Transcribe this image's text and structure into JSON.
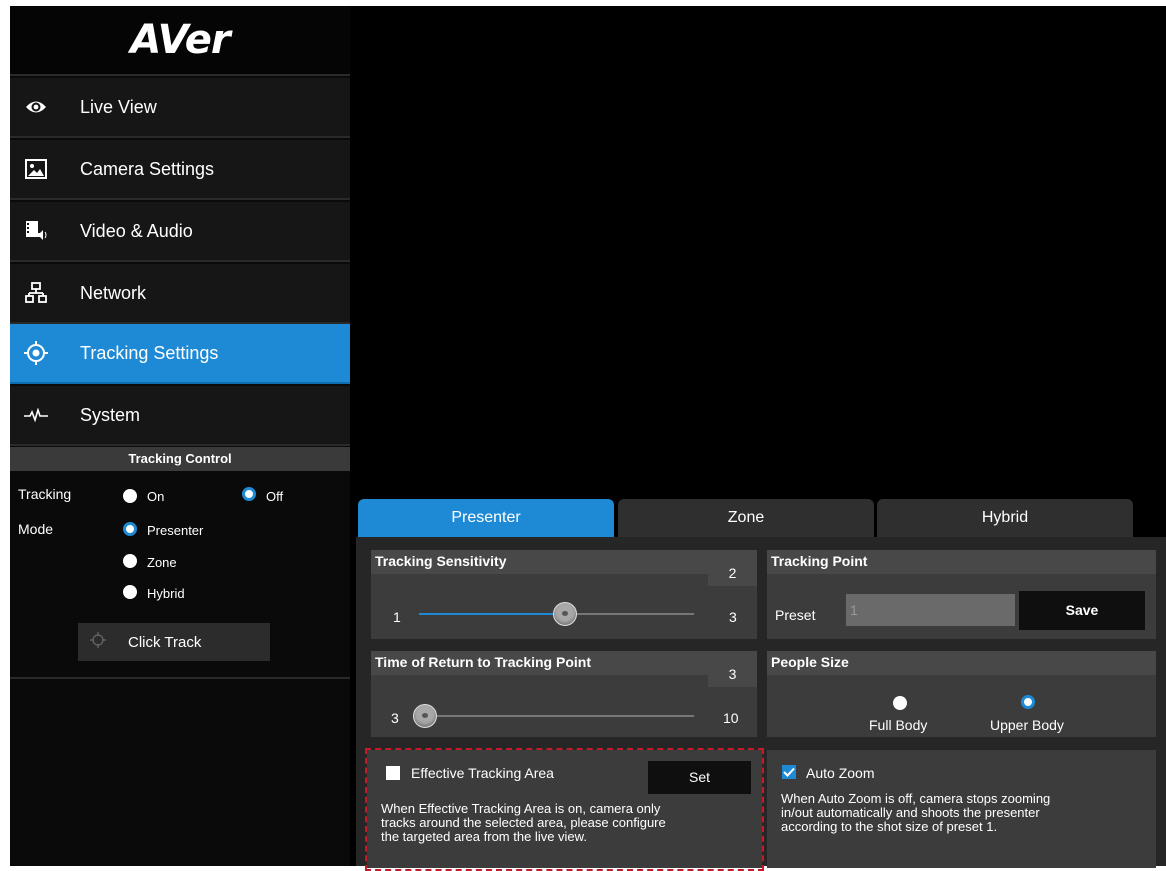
{
  "brand": {
    "logo_text": "AVer"
  },
  "sidebar": {
    "items": [
      {
        "label": "Live View",
        "icon": "eye-icon"
      },
      {
        "label": "Camera Settings",
        "icon": "image-icon"
      },
      {
        "label": "Video & Audio",
        "icon": "film-audio-icon"
      },
      {
        "label": "Network",
        "icon": "network-icon"
      },
      {
        "label": "Tracking Settings",
        "icon": "target-icon",
        "active": true
      },
      {
        "label": "System",
        "icon": "pulse-icon"
      }
    ]
  },
  "tracking_control": {
    "header": "Tracking Control",
    "tracking_label": "Tracking",
    "mode_label": "Mode",
    "on_label": "On",
    "off_label": "Off",
    "tracking_value": "Off",
    "modes": [
      "Presenter",
      "Zone",
      "Hybrid"
    ],
    "mode_value": "Presenter",
    "click_track_label": "Click Track"
  },
  "tabs": [
    {
      "label": "Presenter",
      "active": true
    },
    {
      "label": "Zone",
      "active": false
    },
    {
      "label": "Hybrid",
      "active": false
    }
  ],
  "sensitivity": {
    "title": "Tracking Sensitivity",
    "value": "2",
    "min": "1",
    "max": "3",
    "level": 2
  },
  "tracking_point": {
    "title": "Tracking Point",
    "preset_label": "Preset",
    "preset_value": "1",
    "save_label": "Save"
  },
  "return_time": {
    "title": "Time of Return to Tracking Point",
    "value": "3",
    "min": "3",
    "max": "10",
    "level": 3
  },
  "people_size": {
    "title": "People Size",
    "options": [
      "Full Body",
      "Upper Body"
    ],
    "selected": "Upper Body"
  },
  "effective_area": {
    "label": "Effective Tracking Area",
    "checked": false,
    "set_label": "Set",
    "desc_lines": [
      "When Effective Tracking Area is on, camera only",
      "tracks around the selected area, please configure",
      "the targeted area from the live view."
    ]
  },
  "auto_zoom": {
    "label": "Auto Zoom",
    "checked": true,
    "desc_lines": [
      "When Auto Zoom is off, camera stops zooming",
      "in/out automatically and shoots the presenter",
      "according to the shot size of preset 1."
    ]
  },
  "colors": {
    "accent": "#1e8ad6",
    "highlight": "#c41a2a",
    "background": "#000000"
  }
}
